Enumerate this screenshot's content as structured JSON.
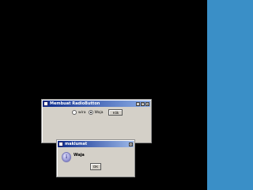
{
  "main_window": {
    "title": "Membuat RadioButton",
    "radio_options": [
      {
        "label": "wira",
        "checked": false
      },
      {
        "label": "Waja",
        "checked": true
      }
    ],
    "button_label": "Klik"
  },
  "dialog": {
    "title": "maklumat",
    "message": "Waja",
    "ok_label": "OK"
  },
  "titlebar_buttons": {
    "minimize": "_",
    "maximize": "□",
    "close": "×"
  },
  "icons": {
    "app": "java-app-icon",
    "info": "information-icon"
  },
  "colors": {
    "desktop": "#000000",
    "side_panel": "#3a8fc7",
    "titlebar_start": "#0a2a8c",
    "window_bg": "#d4d0c8"
  }
}
